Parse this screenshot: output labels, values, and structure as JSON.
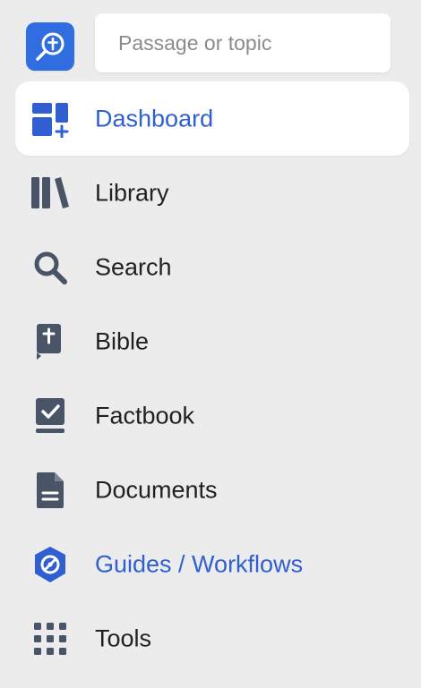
{
  "search": {
    "placeholder": "Passage or topic"
  },
  "nav": {
    "items": [
      {
        "name": "dashboard",
        "label": "Dashboard",
        "icon": "dashboard-icon",
        "active": true
      },
      {
        "name": "library",
        "label": "Library",
        "icon": "library-icon"
      },
      {
        "name": "search",
        "label": "Search",
        "icon": "search-icon"
      },
      {
        "name": "bible",
        "label": "Bible",
        "icon": "bible-icon"
      },
      {
        "name": "factbook",
        "label": "Factbook",
        "icon": "factbook-icon"
      },
      {
        "name": "documents",
        "label": "Documents",
        "icon": "document-icon"
      },
      {
        "name": "guides-workflows",
        "label": "Guides / Workflows",
        "icon": "guides-icon"
      },
      {
        "name": "tools",
        "label": "Tools",
        "icon": "tools-icon"
      }
    ]
  },
  "colors": {
    "accent": "#2f5fd0",
    "logo_bg": "#2f6de0",
    "icon_gray": "#495466",
    "sidebar_bg": "#ececec",
    "active_bg": "#ffffff"
  }
}
